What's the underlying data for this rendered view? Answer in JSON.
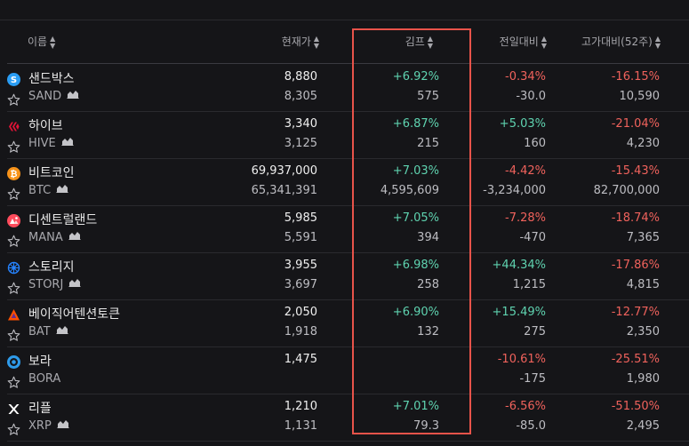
{
  "headers": {
    "name": "이름",
    "price": "현재가",
    "kimp": "김프",
    "change": "전일대비",
    "high": "고가대비(52주)"
  },
  "colors": {
    "positive": "#5fd3b0",
    "negative": "#f0625c",
    "highlight": "#e8534a"
  },
  "rows": [
    {
      "name": "샌드박스",
      "symbol": "SAND",
      "icon": "sand-icon",
      "icon_color": "#2a9df4",
      "price": "8,880",
      "price_usd": "8,305",
      "kimp_pct": "+6.92%",
      "kimp_val": "575",
      "change_pct": "-0.34%",
      "change_val": "-30.0",
      "high_pct": "-16.15%",
      "high_val": "10,590",
      "has_chart": true
    },
    {
      "name": "하이브",
      "symbol": "HIVE",
      "icon": "hive-icon",
      "icon_color": "#e31337",
      "price": "3,340",
      "price_usd": "3,125",
      "kimp_pct": "+6.87%",
      "kimp_val": "215",
      "change_pct": "+5.03%",
      "change_val": "160",
      "high_pct": "-21.04%",
      "high_val": "4,230",
      "has_chart": true
    },
    {
      "name": "비트코인",
      "symbol": "BTC",
      "icon": "bitcoin-icon",
      "icon_color": "#f7931a",
      "price": "69,937,000",
      "price_usd": "65,341,391",
      "kimp_pct": "+7.03%",
      "kimp_val": "4,595,609",
      "change_pct": "-4.42%",
      "change_val": "-3,234,000",
      "high_pct": "-15.43%",
      "high_val": "82,700,000",
      "has_chart": true
    },
    {
      "name": "디센트럴랜드",
      "symbol": "MANA",
      "icon": "mana-icon",
      "icon_color": "#ff4b5c",
      "price": "5,985",
      "price_usd": "5,591",
      "kimp_pct": "+7.05%",
      "kimp_val": "394",
      "change_pct": "-7.28%",
      "change_val": "-470",
      "high_pct": "-18.74%",
      "high_val": "7,365",
      "has_chart": true
    },
    {
      "name": "스토리지",
      "symbol": "STORJ",
      "icon": "storj-icon",
      "icon_color": "#2683ff",
      "price": "3,955",
      "price_usd": "3,697",
      "kimp_pct": "+6.98%",
      "kimp_val": "258",
      "change_pct": "+44.34%",
      "change_val": "1,215",
      "high_pct": "-17.86%",
      "high_val": "4,815",
      "has_chart": true
    },
    {
      "name": "베이직어텐션토큰",
      "symbol": "BAT",
      "icon": "bat-icon",
      "icon_color": "#ff5000",
      "price": "2,050",
      "price_usd": "1,918",
      "kimp_pct": "+6.90%",
      "kimp_val": "132",
      "change_pct": "+15.49%",
      "change_val": "275",
      "high_pct": "-12.77%",
      "high_val": "2,350",
      "has_chart": true
    },
    {
      "name": "보라",
      "symbol": "BORA",
      "icon": "bora-icon",
      "icon_color": "#2e9bea",
      "price": "1,475",
      "price_usd": "",
      "kimp_pct": "",
      "kimp_val": "",
      "change_pct": "-10.61%",
      "change_val": "-175",
      "high_pct": "-25.51%",
      "high_val": "1,980",
      "has_chart": false
    },
    {
      "name": "리플",
      "symbol": "XRP",
      "icon": "xrp-icon",
      "icon_color": "#ffffff",
      "price": "1,210",
      "price_usd": "1,131",
      "kimp_pct": "+7.01%",
      "kimp_val": "79.3",
      "change_pct": "-6.56%",
      "change_val": "-85.0",
      "high_pct": "-51.50%",
      "high_val": "2,495",
      "has_chart": true
    }
  ]
}
